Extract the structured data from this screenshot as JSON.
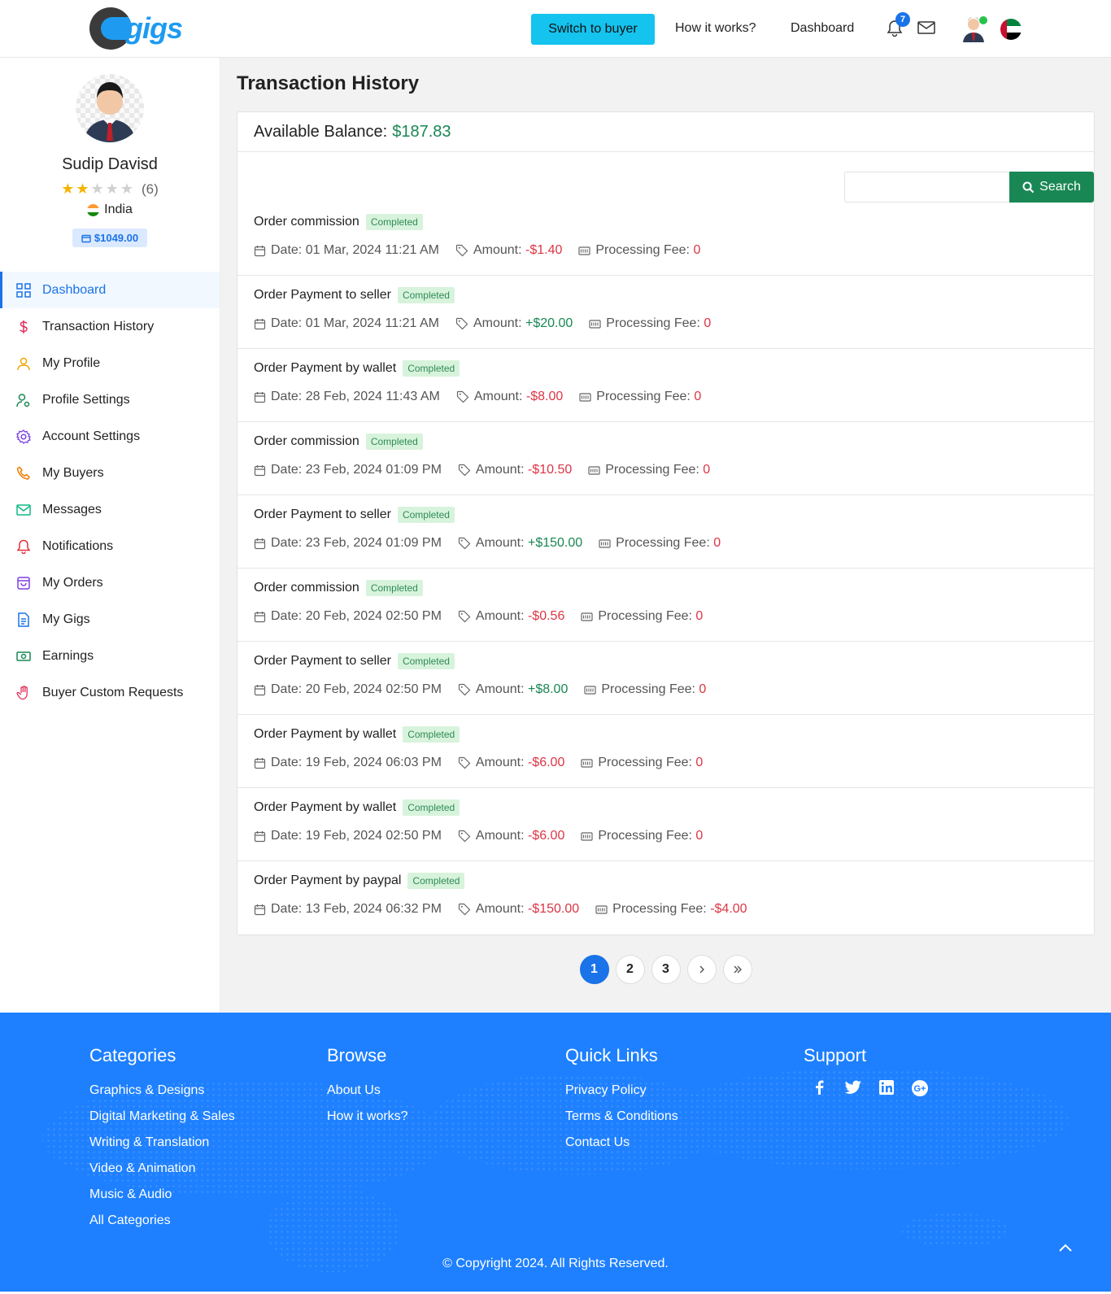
{
  "header": {
    "logo_text": "gigs",
    "switch_label": "Switch to buyer",
    "how_it_works": "How it works?",
    "dashboard": "Dashboard",
    "notification_count": "7"
  },
  "profile": {
    "name": "Sudip Davisd",
    "rating_count": "(6)",
    "country": "India",
    "balance": "$1049.00",
    "stars_filled": 2,
    "stars_total": 5
  },
  "menu": [
    {
      "label": "Dashboard",
      "icon": "grid-icon",
      "active": true
    },
    {
      "label": "Transaction History",
      "icon": "dollar-icon"
    },
    {
      "label": "My Profile",
      "icon": "user-icon"
    },
    {
      "label": "Profile Settings",
      "icon": "user-settings-icon"
    },
    {
      "label": "Account Settings",
      "icon": "gear-icon"
    },
    {
      "label": "My Buyers",
      "icon": "phone-icon"
    },
    {
      "label": "Messages",
      "icon": "mail-icon"
    },
    {
      "label": "Notifications",
      "icon": "bell-icon"
    },
    {
      "label": "My Orders",
      "icon": "bag-icon"
    },
    {
      "label": "My Gigs",
      "icon": "document-icon"
    },
    {
      "label": "Earnings",
      "icon": "cash-icon"
    },
    {
      "label": "Buyer Custom Requests",
      "icon": "hand-icon"
    }
  ],
  "main": {
    "title": "Transaction History",
    "balance_label": "Available Balance:",
    "balance_value": "$187.83",
    "search_button": "Search",
    "search_value": ""
  },
  "transactions": [
    {
      "title": "Order commission",
      "status": "Completed",
      "date": "Date: 01 Mar, 2024 11:21 AM",
      "amount": "-$1.40",
      "fee": "0"
    },
    {
      "title": "Order Payment to seller",
      "status": "Completed",
      "date": "Date: 01 Mar, 2024 11:21 AM",
      "amount": "+$20.00",
      "fee": "0"
    },
    {
      "title": "Order Payment by wallet",
      "status": "Completed",
      "date": "Date: 28 Feb, 2024 11:43 AM",
      "amount": "-$8.00",
      "fee": "0"
    },
    {
      "title": "Order commission",
      "status": "Completed",
      "date": "Date: 23 Feb, 2024 01:09 PM",
      "amount": "-$10.50",
      "fee": "0"
    },
    {
      "title": "Order Payment to seller",
      "status": "Completed",
      "date": "Date: 23 Feb, 2024 01:09 PM",
      "amount": "+$150.00",
      "fee": "0"
    },
    {
      "title": "Order commission",
      "status": "Completed",
      "date": "Date: 20 Feb, 2024 02:50 PM",
      "amount": "-$0.56",
      "fee": "0"
    },
    {
      "title": "Order Payment to seller",
      "status": "Completed",
      "date": "Date: 20 Feb, 2024 02:50 PM",
      "amount": "+$8.00",
      "fee": "0"
    },
    {
      "title": "Order Payment by wallet",
      "status": "Completed",
      "date": "Date: 19 Feb, 2024 06:03 PM",
      "amount": "-$6.00",
      "fee": "0"
    },
    {
      "title": "Order Payment by wallet",
      "status": "Completed",
      "date": "Date: 19 Feb, 2024 02:50 PM",
      "amount": "-$6.00",
      "fee": "0"
    },
    {
      "title": "Order Payment by paypal",
      "status": "Completed",
      "date": "Date: 13 Feb, 2024 06:32 PM",
      "amount": "-$150.00",
      "fee": "-$4.00"
    }
  ],
  "labels": {
    "amount": "Amount:",
    "fee": "Processing Fee:"
  },
  "pagination": [
    "1",
    "2",
    "3"
  ],
  "footer": {
    "categories_title": "Categories",
    "categories": [
      "Graphics & Designs",
      "Digital Marketing & Sales",
      "Writing & Translation",
      "Video & Animation",
      "Music & Audio",
      "All Categories"
    ],
    "browse_title": "Browse",
    "browse": [
      "About Us",
      "How it works?"
    ],
    "quick_title": "Quick Links",
    "quick": [
      "Privacy Policy",
      "Terms & Conditions",
      "Contact Us"
    ],
    "support_title": "Support",
    "copyright": "© Copyright 2024. All Rights Reserved."
  },
  "colors": {
    "accent": "#1a73e8",
    "positive": "#198754",
    "negative": "#dc3545",
    "footer": "#1e80ff",
    "switch": "#14c3ee"
  }
}
